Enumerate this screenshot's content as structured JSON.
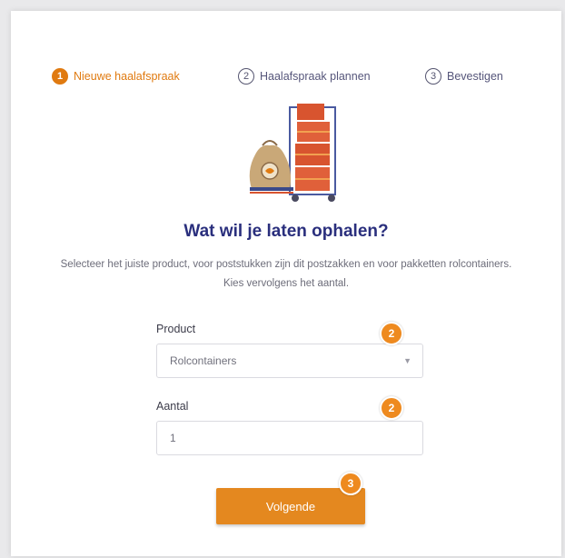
{
  "stepper": {
    "steps": [
      {
        "number": "1",
        "label": "Nieuwe haalafspraak",
        "active": true
      },
      {
        "number": "2",
        "label": "Haalafspraak plannen",
        "active": false
      },
      {
        "number": "3",
        "label": "Bevestigen",
        "active": false
      }
    ]
  },
  "illustration": {
    "icon": "mailbag-and-roll-container-illustration"
  },
  "main": {
    "title": "Wat wil je laten ophalen?",
    "description": "Selecteer het juiste product, voor poststukken zijn dit postzakken en voor pakketten rolcontainers. Kies vervolgens het aantal."
  },
  "form": {
    "product_label": "Product",
    "product_value": "Rolcontainers",
    "amount_label": "Aantal",
    "amount_value": "1",
    "next_label": "Volgende"
  },
  "annotations": {
    "badge1": "2",
    "badge2": "2",
    "badge3": "3"
  },
  "colors": {
    "accent": "#e4881f",
    "title": "#2a2f7d",
    "background": "#e9e9eb"
  }
}
